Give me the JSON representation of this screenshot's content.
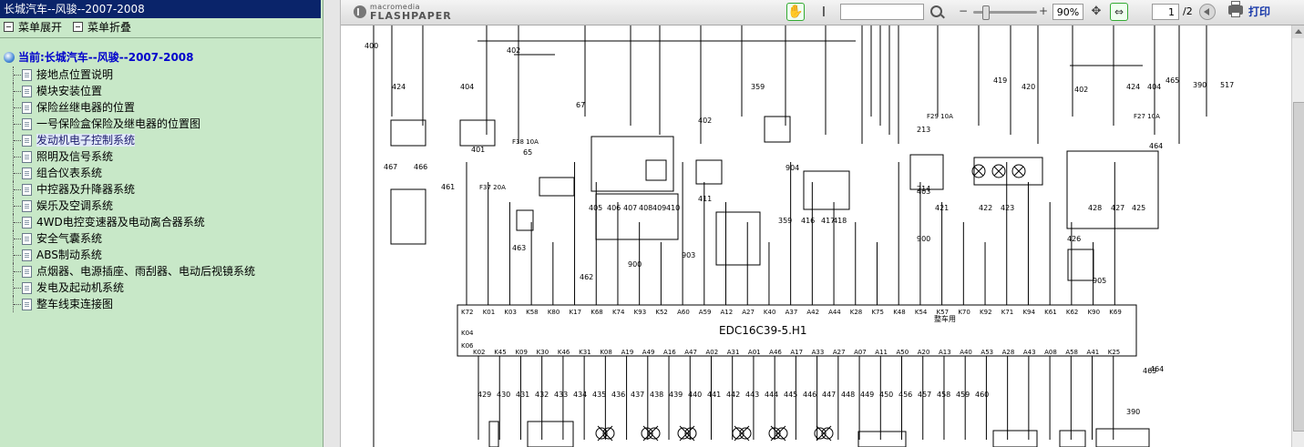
{
  "left_panel": {
    "title": "长城汽车--风骏--2007-2008",
    "expand_label": "菜单展开",
    "collapse_label": "菜单折叠",
    "current_label": "当前:长城汽车--风骏--2007-2008",
    "items": [
      {
        "label": "接地点位置说明"
      },
      {
        "label": "模块安装位置"
      },
      {
        "label": "保险丝继电器的位置"
      },
      {
        "label": "一号保险盒保险及继电器的位置图"
      },
      {
        "label": "发动机电子控制系统"
      },
      {
        "label": "照明及信号系统"
      },
      {
        "label": "组合仪表系统"
      },
      {
        "label": "中控器及升降器系统"
      },
      {
        "label": "娱乐及空调系统"
      },
      {
        "label": "4WD电控变速器及电动离合器系统"
      },
      {
        "label": "安全气囊系统"
      },
      {
        "label": "ABS制动系统"
      },
      {
        "label": "点烟器、电源插座、雨刮器、电动后视镜系统"
      },
      {
        "label": "发电及起动机系统"
      },
      {
        "label": "整车线束连接图"
      }
    ]
  },
  "toolbar": {
    "logo_line1": "macromedia",
    "logo_line2": "FLASHPAPER",
    "zoom": "90%",
    "page": "1",
    "page_total": "/2",
    "print_label": "打印"
  },
  "diagram": {
    "ecu_label": "EDC16C39-5.H1",
    "top_pins": [
      "K72",
      "K01",
      "K03",
      "K58",
      "K80",
      "K17",
      "K68",
      "K74",
      "K93",
      "K52",
      "A60",
      "A59",
      "A12",
      "A27",
      "K40",
      "A37",
      "A42",
      "A44",
      "K28",
      "K75",
      "K48",
      "K54",
      "K57",
      "K70",
      "K92",
      "K71",
      "K94",
      "K61",
      "K62",
      "K90",
      "K69"
    ],
    "bottom_pins": [
      "K02",
      "K45",
      "K09",
      "K30",
      "K46",
      "K31",
      "K08",
      "A19",
      "A49",
      "A16",
      "A47",
      "A02",
      "A31",
      "A01",
      "A46",
      "A17",
      "A33",
      "A27",
      "A07",
      "A11",
      "A50",
      "A20",
      "A13",
      "A40",
      "A53",
      "A28",
      "A43",
      "A08",
      "A58",
      "A41",
      "K25"
    ],
    "side_pins": [
      "K04",
      "K06"
    ],
    "wire_numbers_top": [
      "400",
      "424",
      "404",
      "402",
      "67",
      "359",
      "402",
      "411",
      "359",
      "904",
      "416",
      "417",
      "418",
      "213",
      "214",
      "403",
      "900",
      "421",
      "422",
      "423",
      "419",
      "420",
      "402",
      "424",
      "404",
      "464",
      "465",
      "390",
      "517",
      "426",
      "428",
      "427",
      "425",
      "905",
      "463",
      "461",
      "462",
      "466",
      "467",
      "401",
      "65",
      "405",
      "406",
      "407",
      "408",
      "409",
      "410",
      "903",
      "900"
    ],
    "wire_numbers_bottom": [
      "429",
      "430",
      "431",
      "432",
      "433",
      "434",
      "435",
      "436",
      "437",
      "438",
      "439",
      "440",
      "441",
      "442",
      "443",
      "444",
      "445",
      "446",
      "447",
      "448",
      "449",
      "450",
      "456",
      "457",
      "458",
      "459",
      "460",
      "465",
      "464",
      "390"
    ],
    "fuse_labels": [
      "F38 10A",
      "F37 20A",
      "F29 10A",
      "F27 10A"
    ],
    "note_label": "整车用"
  }
}
